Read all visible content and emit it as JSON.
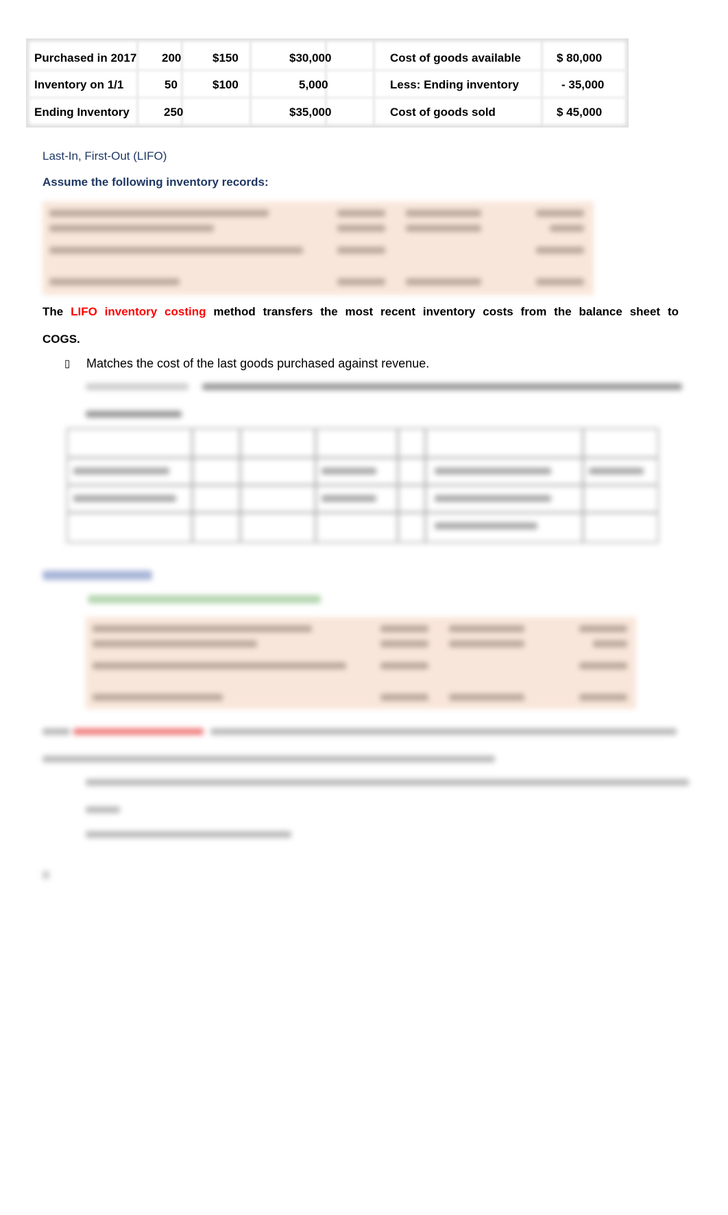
{
  "top_table": {
    "left_rows": [
      {
        "label": "Purchased in 2017",
        "units": "200",
        "unit_cost": "$150",
        "total": "$30,000"
      },
      {
        "label": "Inventory on 1/1",
        "units": "50",
        "unit_cost": "$100",
        "total": "5,000"
      },
      {
        "label": "Ending Inventory",
        "units": "250",
        "unit_cost": "",
        "total": "$35,000"
      }
    ],
    "right_rows": [
      {
        "label": "Cost of goods available",
        "value": "$ 80,000"
      },
      {
        "label": "Less: Ending inventory",
        "value": "- 35,000"
      },
      {
        "label": "Cost of goods sold",
        "value": "$ 45,000"
      }
    ]
  },
  "lifo": {
    "heading": "Last-In, First-Out (LIFO)",
    "assume": "Assume the following inventory records:",
    "para_prefix": "The ",
    "para_highlight": "LIFO inventory costing",
    "para_rest": " method transfers the most recent inventory costs from the balance sheet to",
    "para_line2": "COGS.",
    "bullet_glyph": "▯",
    "bullet1": "Matches the cost of the last goods purchased against revenue."
  },
  "colors": {
    "heading": "#1f3864",
    "highlight": "#ff0000",
    "records_bg": "#f9e6da"
  }
}
